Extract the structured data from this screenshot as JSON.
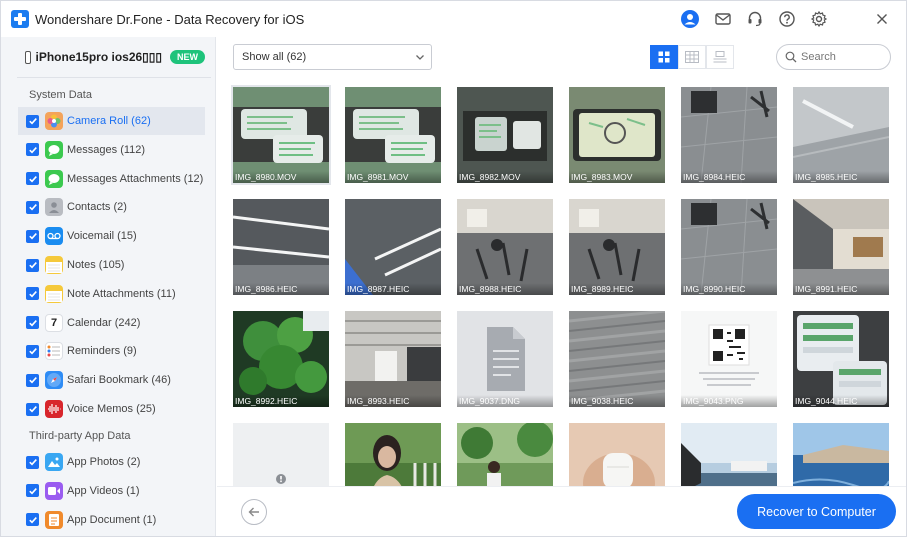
{
  "app": {
    "title": "Wondershare Dr.Fone - Data Recovery for iOS"
  },
  "titlebar": {
    "icons": [
      "account-icon",
      "mail-icon",
      "support-headset-icon",
      "help-icon",
      "settings-gear-icon",
      "close-icon"
    ]
  },
  "device": {
    "name": "iPhone15pro ios26▯▯▯",
    "badge": "NEW"
  },
  "sidebar": {
    "system_heading": "System Data",
    "third_party_heading": "Third-party App Data",
    "system_items": [
      {
        "label": "Camera Roll (62)",
        "icon": "photos-icon",
        "color": "#f4a35a",
        "active": true
      },
      {
        "label": "Messages (112)",
        "icon": "messages-icon",
        "color": "#3cc94f"
      },
      {
        "label": "Messages Attachments (12)",
        "icon": "messages-icon",
        "color": "#3cc94f"
      },
      {
        "label": "Contacts (2)",
        "icon": "contacts-icon",
        "color": "#b9bcc2"
      },
      {
        "label": "Voicemail (15)",
        "icon": "voicemail-icon",
        "color": "#1a8cf0"
      },
      {
        "label": "Notes (105)",
        "icon": "notes-icon",
        "color": "#f5c93b"
      },
      {
        "label": "Note Attachments (11)",
        "icon": "notes-icon",
        "color": "#f5c93b"
      },
      {
        "label": "Calendar (242)",
        "icon": "calendar-icon",
        "color": "#ffffff",
        "glyph": "7"
      },
      {
        "label": "Reminders (9)",
        "icon": "reminders-icon",
        "color": "#ffffff"
      },
      {
        "label": "Safari Bookmark (46)",
        "icon": "safari-icon",
        "color": "#2e8cf5"
      },
      {
        "label": "Voice Memos (25)",
        "icon": "voice-memos-icon",
        "color": "#d8262c"
      }
    ],
    "third_party_items": [
      {
        "label": "App Photos (2)",
        "icon": "app-photos-icon",
        "color": "#39a7f2"
      },
      {
        "label": "App Videos (1)",
        "icon": "app-videos-icon",
        "color": "#9a5cf0"
      },
      {
        "label": "App Document (1)",
        "icon": "app-document-icon",
        "color": "#f08a2c"
      }
    ]
  },
  "toolbar": {
    "filter_value": "Show all (62)",
    "search_placeholder": "Search",
    "view_modes": [
      "grid-view-icon",
      "list-view-icon",
      "detail-view-icon"
    ]
  },
  "grid": {
    "items": [
      {
        "caption": "IMG_8980.MOV",
        "style": "phone-green"
      },
      {
        "caption": "IMG_8981.MOV",
        "style": "phone-green"
      },
      {
        "caption": "IMG_8982.MOV",
        "style": "phone-dark"
      },
      {
        "caption": "IMG_8983.MOV",
        "style": "phone-cartoon"
      },
      {
        "caption": "IMG_8984.HEIC",
        "style": "office-floor"
      },
      {
        "caption": "IMG_8985.HEIC",
        "style": "ceiling"
      },
      {
        "caption": "IMG_8986.HEIC",
        "style": "ceiling-lights"
      },
      {
        "caption": "IMG_8987.HEIC",
        "style": "ceiling-blue"
      },
      {
        "caption": "IMG_8988.HEIC",
        "style": "office-chairs"
      },
      {
        "caption": "IMG_8989.HEIC",
        "style": "office-chairs"
      },
      {
        "caption": "IMG_8990.HEIC",
        "style": "office-floor"
      },
      {
        "caption": "IMG_8991.HEIC",
        "style": "hallway"
      },
      {
        "caption": "IMG_8992.HEIC",
        "style": "plant"
      },
      {
        "caption": "IMG_8993.HEIC",
        "style": "stairs"
      },
      {
        "caption": "IMG_9037.DNG",
        "style": "doc-placeholder"
      },
      {
        "caption": "IMG_9038.HEIC",
        "style": "carpet"
      },
      {
        "caption": "IMG_9043.PNG",
        "style": "qr-code"
      },
      {
        "caption": "IMG_9044.HEIC",
        "style": "phone-screens"
      },
      {
        "caption": "",
        "style": "loading"
      },
      {
        "caption": "",
        "style": "girl"
      },
      {
        "caption": "",
        "style": "park"
      },
      {
        "caption": "",
        "style": "earbuds"
      },
      {
        "caption": "",
        "style": "ferry"
      },
      {
        "caption": "",
        "style": "coast"
      }
    ]
  },
  "footer": {
    "recover_label": "Recover to Computer"
  },
  "colors": {
    "accent": "#1a6ff2",
    "badge": "#1ec37b",
    "sidebar_bg": "#f3f5f8"
  }
}
